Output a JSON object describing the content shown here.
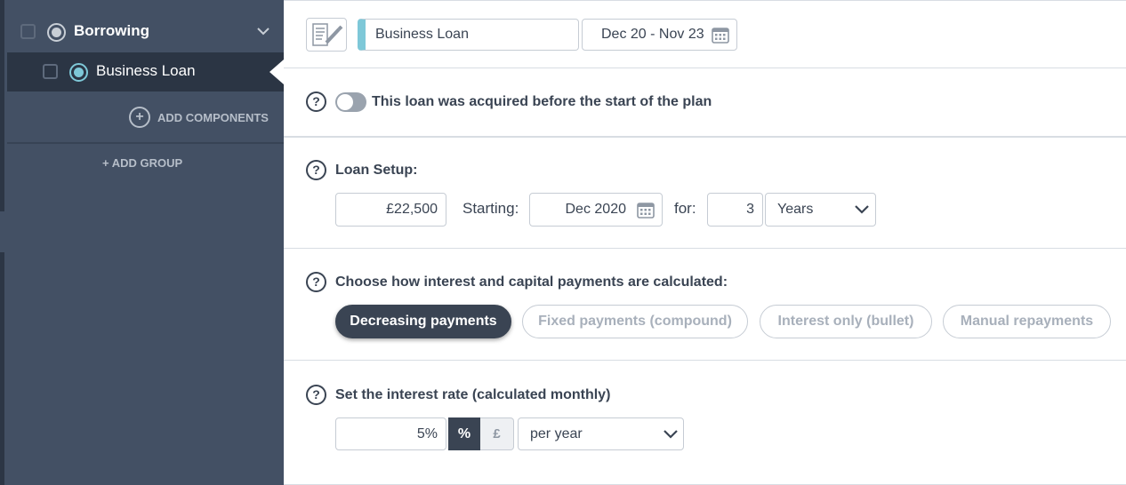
{
  "sidebar": {
    "group_title": "Borrowing",
    "component_title": "Business Loan",
    "add_components_label": "ADD COMPONENTS",
    "add_components_icon": "plus-circle-icon",
    "add_group_label": "+ ADD GROUP"
  },
  "header": {
    "component_name": "Business Loan",
    "date_range": "Dec 20 - Nov 23",
    "notes_icon": "notes-edit-icon",
    "calendar_icon": "calendar-icon"
  },
  "acquired": {
    "help": "?",
    "toggle_on": false,
    "label": "This loan was acquired before the start of the plan"
  },
  "loan_setup": {
    "help": "?",
    "title": "Loan Setup:",
    "amount": "£22,500",
    "starting_label": "Starting:",
    "start_date": "Dec 2020",
    "for_label": "for:",
    "duration": "3",
    "duration_unit": "Years"
  },
  "payments": {
    "help": "?",
    "title": "Choose how interest and capital payments are calculated:",
    "options": [
      "Decreasing payments",
      "Fixed payments (compound)",
      "Interest only (bullet)",
      "Manual repayments"
    ],
    "selected": "Decreasing payments"
  },
  "interest": {
    "help": "?",
    "title": "Set the interest rate (calculated monthly)",
    "rate": "5%",
    "unit_percent": "%",
    "unit_currency": "£",
    "unit_selected": "%",
    "period": "per year"
  },
  "colors": {
    "sidebar_bg": "#435064",
    "sidebar_active_bg": "#2b3544",
    "accent": "#7ec8d8",
    "primary_dark": "#3a4453"
  }
}
